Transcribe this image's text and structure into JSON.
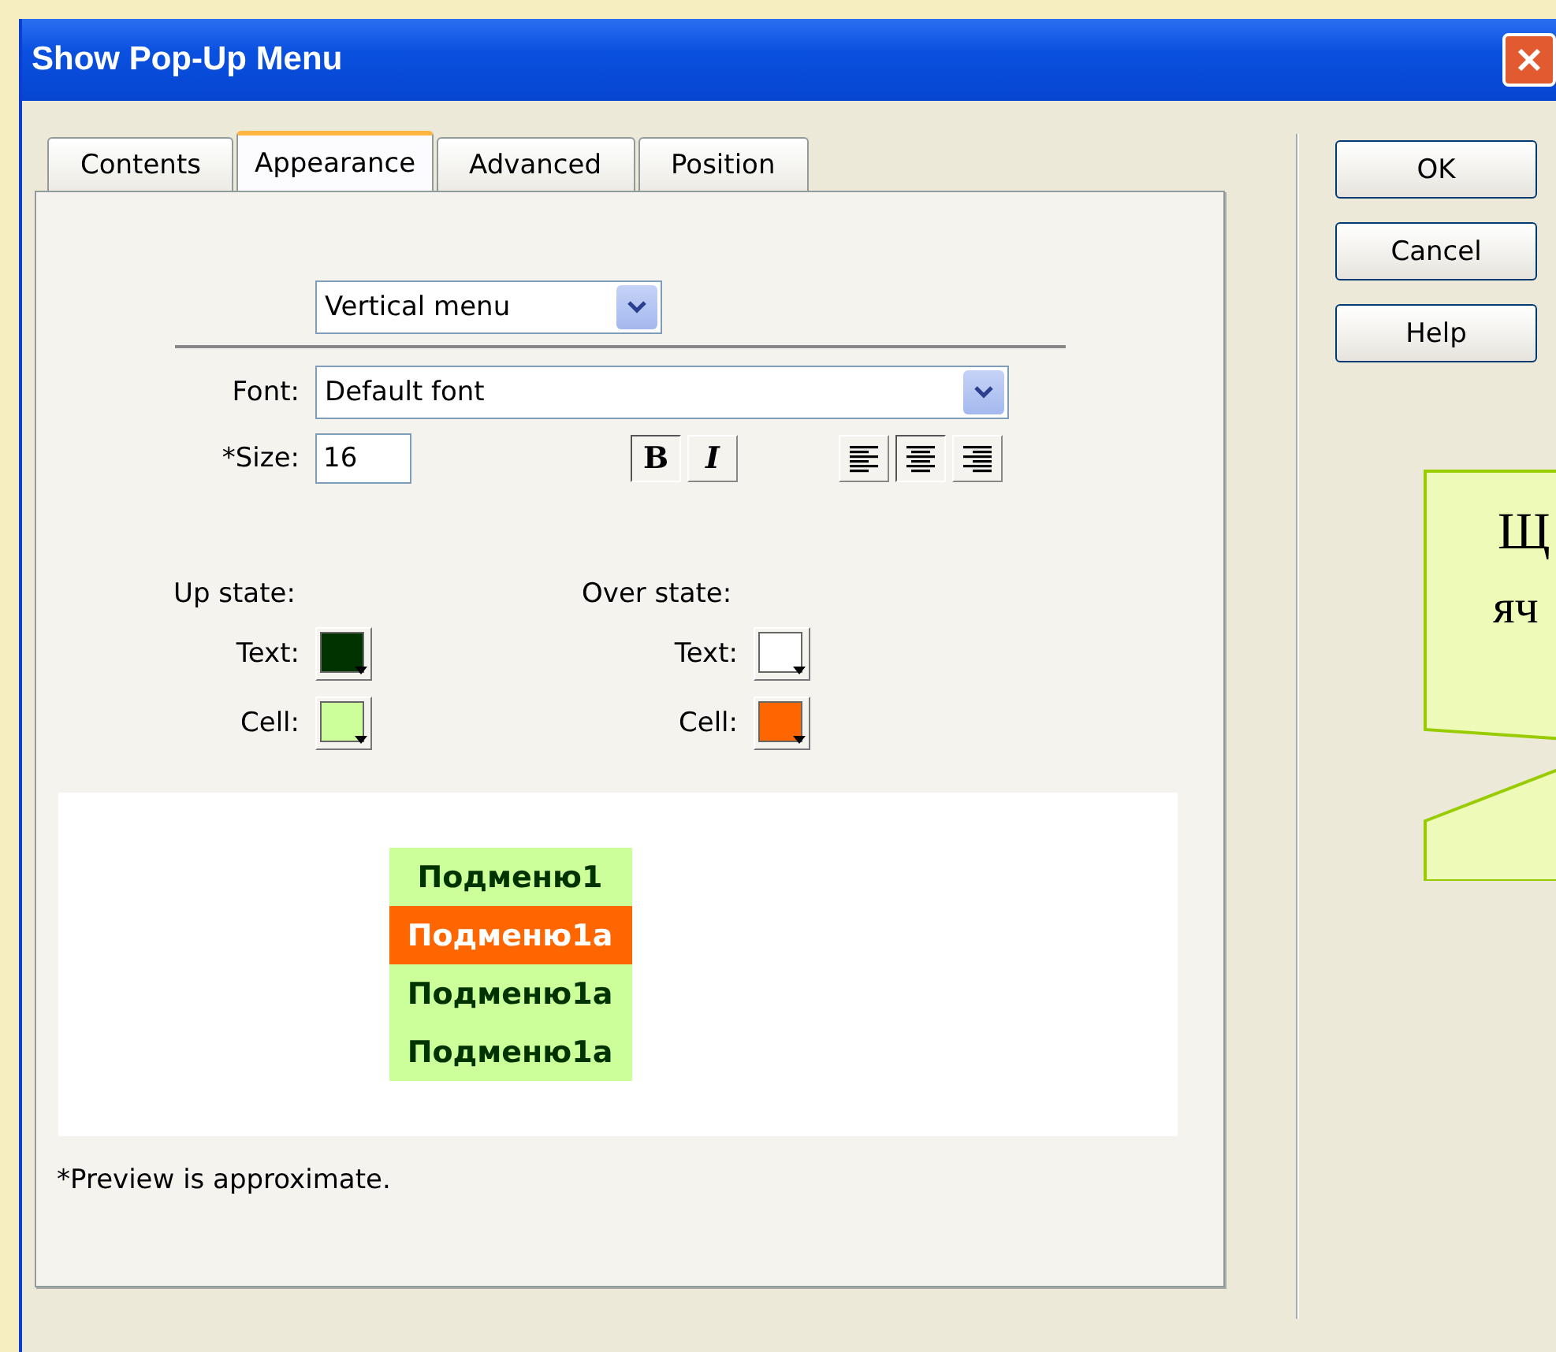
{
  "window": {
    "title": "Show Pop-Up Menu"
  },
  "tabs": [
    {
      "label": "Contents",
      "selected": false
    },
    {
      "label": "Appearance",
      "selected": true
    },
    {
      "label": "Advanced",
      "selected": false
    },
    {
      "label": "Position",
      "selected": false
    }
  ],
  "menu_type": {
    "value": "Vertical menu"
  },
  "font": {
    "label": "Font:",
    "value": "Default font"
  },
  "size": {
    "label": "*Size:",
    "value": "16"
  },
  "style_buttons": [
    {
      "kind": "bold",
      "label": "B",
      "pressed": true
    },
    {
      "kind": "italic",
      "label": "I",
      "pressed": false
    }
  ],
  "align_buttons": [
    {
      "kind": "left",
      "pressed": false
    },
    {
      "kind": "center",
      "pressed": true
    },
    {
      "kind": "right",
      "pressed": false
    }
  ],
  "states": [
    {
      "title": "Up state:",
      "swatches": [
        {
          "label": "Text:",
          "color": "#003300"
        },
        {
          "label": "Cell:",
          "color": "#ccff99"
        }
      ]
    },
    {
      "title": "Over state:",
      "swatches": [
        {
          "label": "Text:",
          "color": "#ffffff"
        },
        {
          "label": "Cell:",
          "color": "#ff6600"
        }
      ]
    }
  ],
  "preview": [
    {
      "label": "Подменю1",
      "hover": false
    },
    {
      "label": "Подменю1а",
      "hover": true
    },
    {
      "label": "Подменю1а",
      "hover": false
    },
    {
      "label": "Подменю1а",
      "hover": false
    }
  ],
  "footnote": "*Preview is approximate.",
  "buttons": [
    "OK",
    "Cancel",
    "Help"
  ],
  "callout": {
    "lines": [
      "Щ",
      "яч"
    ]
  }
}
